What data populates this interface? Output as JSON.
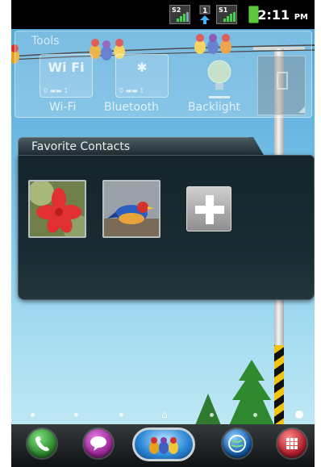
{
  "status_bar": {
    "sim1_label": "S2",
    "data_label": "1",
    "sim2_label": "S1",
    "time": "2:11",
    "ampm": "PM",
    "battery_color": "#5ec93a"
  },
  "tools_widget": {
    "title": "Tools",
    "items": [
      {
        "label": "Wi-Fi",
        "icon": "wifi-icon",
        "glyph": "Wi Fi",
        "level": "0 ▬▬ 1"
      },
      {
        "label": "Bluetooth",
        "icon": "bluetooth-icon",
        "glyph": "✱",
        "level": "0 ▬▬ 1"
      },
      {
        "label": "Backlight",
        "icon": "lightbulb-icon",
        "glyph": "",
        "level": ""
      }
    ],
    "battery_icon": "battery-icon"
  },
  "favorite_contacts": {
    "title": "Favorite Contacts",
    "contacts": [
      {
        "name": "contact-1",
        "photo": "flower-photo"
      },
      {
        "name": "contact-2",
        "photo": "bird-photo"
      }
    ],
    "add_icon": "plus-icon"
  },
  "dock": {
    "apps": [
      {
        "icon": "phone-icon",
        "color": "#2e8b2e"
      },
      {
        "icon": "messaging-icon",
        "color": "#a0299a"
      },
      {
        "icon": "birds-icon",
        "color": "#2a86d6"
      },
      {
        "icon": "browser-icon",
        "color": "#1560b0"
      },
      {
        "icon": "app-drawer-icon",
        "color": "#b3212e"
      }
    ]
  },
  "colors": {
    "sky_top": "#4fa5d8",
    "widget_dark": "#15252c"
  }
}
